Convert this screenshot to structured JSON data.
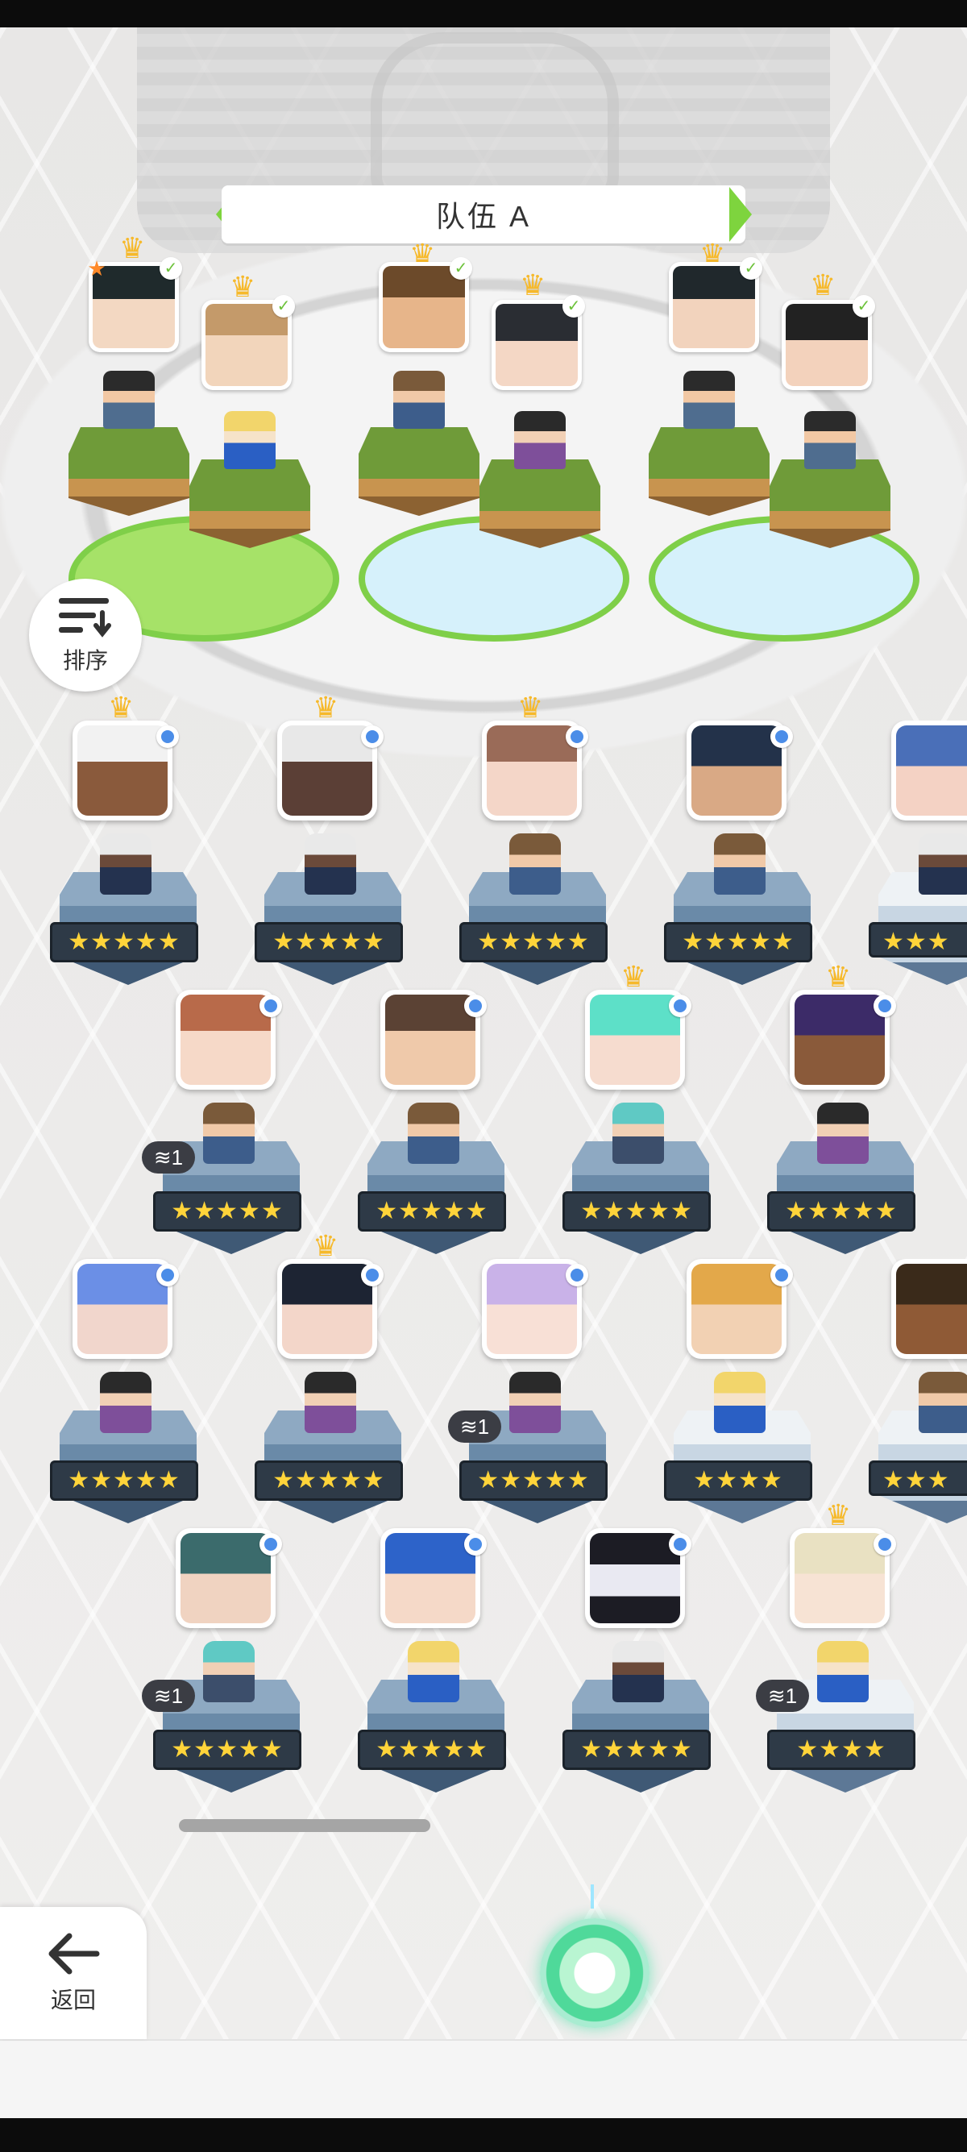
{
  "team": {
    "title": "队伍 A"
  },
  "controls": {
    "sort_label": "排序",
    "back_label": "返回"
  },
  "roster": [
    {
      "stars": "★★★★★",
      "badge": ""
    },
    {
      "stars": "★★★★★",
      "badge": ""
    },
    {
      "stars": "★★★★★",
      "badge": ""
    },
    {
      "stars": "★★★★★",
      "badge": ""
    },
    {
      "stars": "★★★",
      "badge": ""
    },
    {
      "stars": "★★★★★",
      "badge": "1"
    },
    {
      "stars": "★★★★★",
      "badge": ""
    },
    {
      "stars": "★★★★★",
      "badge": ""
    },
    {
      "stars": "★★★★★",
      "badge": ""
    },
    {
      "stars": "★★★★★",
      "badge": ""
    },
    {
      "stars": "★★★★★",
      "badge": ""
    },
    {
      "stars": "★★★★★",
      "badge": "1"
    },
    {
      "stars": "★★★★",
      "badge": ""
    },
    {
      "stars": "★★★",
      "badge": ""
    },
    {
      "stars": "★★★★★",
      "badge": "1"
    },
    {
      "stars": "★★★★★",
      "badge": ""
    },
    {
      "stars": "★★★★★",
      "badge": ""
    },
    {
      "stars": "★★★★",
      "badge": "1"
    }
  ],
  "colors": {
    "accent_green": "#7ed43e",
    "star_yellow": "#ffd43a",
    "crown_gold": "#f6b92b",
    "dot_blue": "#4b8de8"
  },
  "icons": {
    "sort": "sort-list-icon",
    "back": "arrow-left-icon",
    "crown": "crown-icon",
    "leaf": "leaf-icon",
    "orb": "glowing-orb-icon"
  }
}
